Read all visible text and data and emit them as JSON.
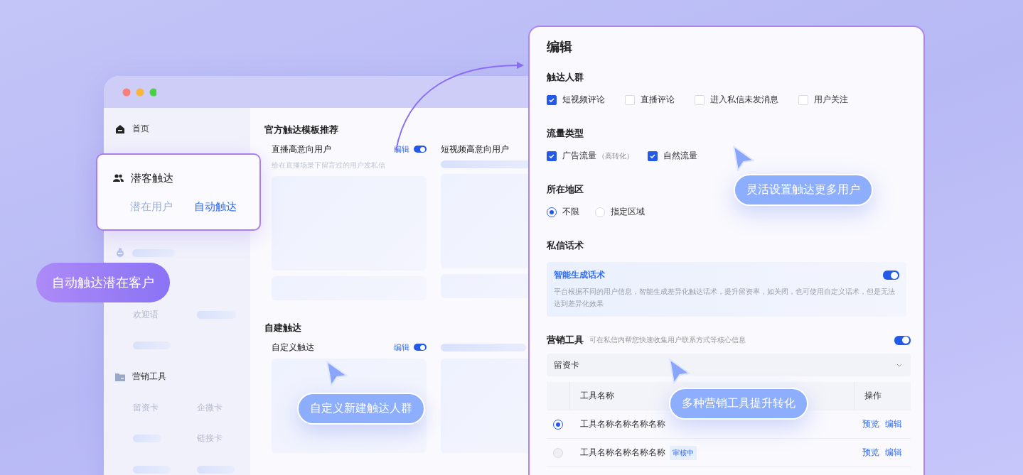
{
  "back_window": {
    "sidebar": {
      "home": "首页",
      "expanded_group": {
        "title": "潜客触达",
        "items": [
          {
            "label": "潜在用户",
            "selected": false
          },
          {
            "label": "自动触达",
            "selected": true
          }
        ]
      },
      "welcome": "欢迎语",
      "tools_group": {
        "title": "营销工具",
        "items": [
          "留资卡",
          "企微卡",
          "链接卡"
        ]
      }
    },
    "official": {
      "title": "官方触达模板推荐",
      "cards": [
        {
          "title": "直播高意向用户",
          "edit": "编辑",
          "on": true,
          "description": "给在直播场景下留言过的用户发私信"
        },
        {
          "title": "短视频高意向用户"
        }
      ]
    },
    "custom": {
      "title": "自建触达",
      "cards": [
        {
          "title": "自定义触达",
          "edit": "编辑",
          "on": true
        }
      ]
    }
  },
  "edit_panel": {
    "title": "编辑",
    "audience": {
      "label": "触达人群",
      "options": [
        {
          "label": "短视频评论",
          "checked": true
        },
        {
          "label": "直播评论",
          "checked": false
        },
        {
          "label": "进入私信未发消息",
          "checked": false
        },
        {
          "label": "用户关注",
          "checked": false
        }
      ]
    },
    "traffic": {
      "label": "流量类型",
      "options": [
        {
          "label": "广告流量",
          "note": "（高转化）",
          "checked": true
        },
        {
          "label": "自然流量",
          "checked": true
        }
      ]
    },
    "region": {
      "label": "所在地区",
      "options": [
        {
          "label": "不限",
          "selected": true
        },
        {
          "label": "指定区域",
          "selected": false
        }
      ]
    },
    "script": {
      "label": "私信话术",
      "card": {
        "title": "智能生成话术",
        "on": true,
        "description": "平台根据不同的用户信息，智能生成差异化触达话术，提升留资率，如关闭，也可使用自定义话术，但是无法达到差异化效果"
      }
    },
    "tools": {
      "label": "营销工具",
      "hint": "可在私信内帮您快速收集用户联系方式等核心信息",
      "on": true,
      "select": {
        "value": "留资卡"
      },
      "table": {
        "columns": [
          "工具名称",
          "操作"
        ],
        "rows": [
          {
            "name": "工具名称名称名称名称",
            "selected": true,
            "actions": [
              "预览",
              "编辑"
            ]
          },
          {
            "name": "工具名称名称名称名称",
            "badge": "审核中",
            "selected": false,
            "actions": [
              "预览",
              "编辑"
            ]
          }
        ]
      }
    }
  },
  "callouts": [
    {
      "text": "自动触达潜在客户",
      "kind": "primary"
    },
    {
      "text": "灵活设置触达更多用户",
      "kind": "soft"
    },
    {
      "text": "自定义新建触达人群",
      "kind": "soft"
    },
    {
      "text": "多种营销工具提升转化",
      "kind": "soft"
    }
  ]
}
